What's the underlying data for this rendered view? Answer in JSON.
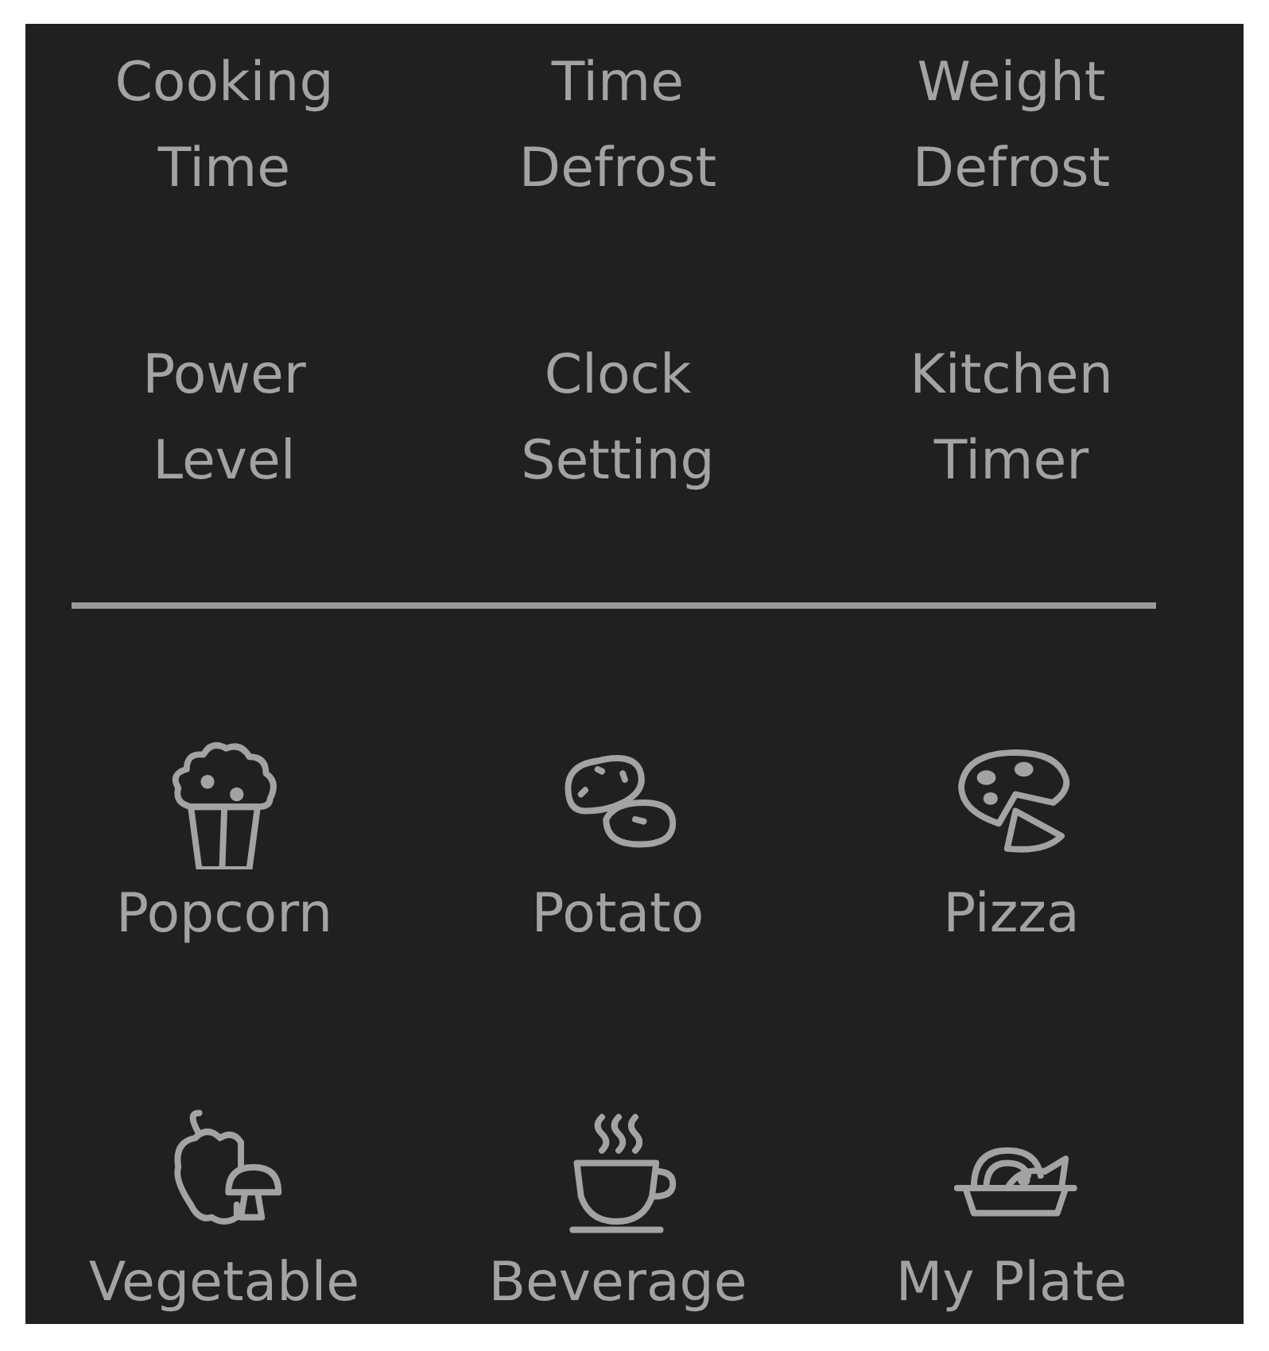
{
  "function_keys": [
    {
      "label": "Cooking Time"
    },
    {
      "label": "Time Defrost"
    },
    {
      "label": "Weight Defrost"
    },
    {
      "label": "Power Level"
    },
    {
      "label": "Clock Setting"
    },
    {
      "label": "Kitchen Timer"
    }
  ],
  "auto_menu": [
    {
      "label": "Popcorn",
      "kind": "popcorn"
    },
    {
      "label": "Potato",
      "kind": "potato"
    },
    {
      "label": "Pizza",
      "kind": "pizza"
    },
    {
      "label": "Vegetable",
      "kind": "vegetable"
    },
    {
      "label": "Beverage",
      "kind": "beverage"
    },
    {
      "label": "My Plate",
      "kind": "plate"
    }
  ]
}
